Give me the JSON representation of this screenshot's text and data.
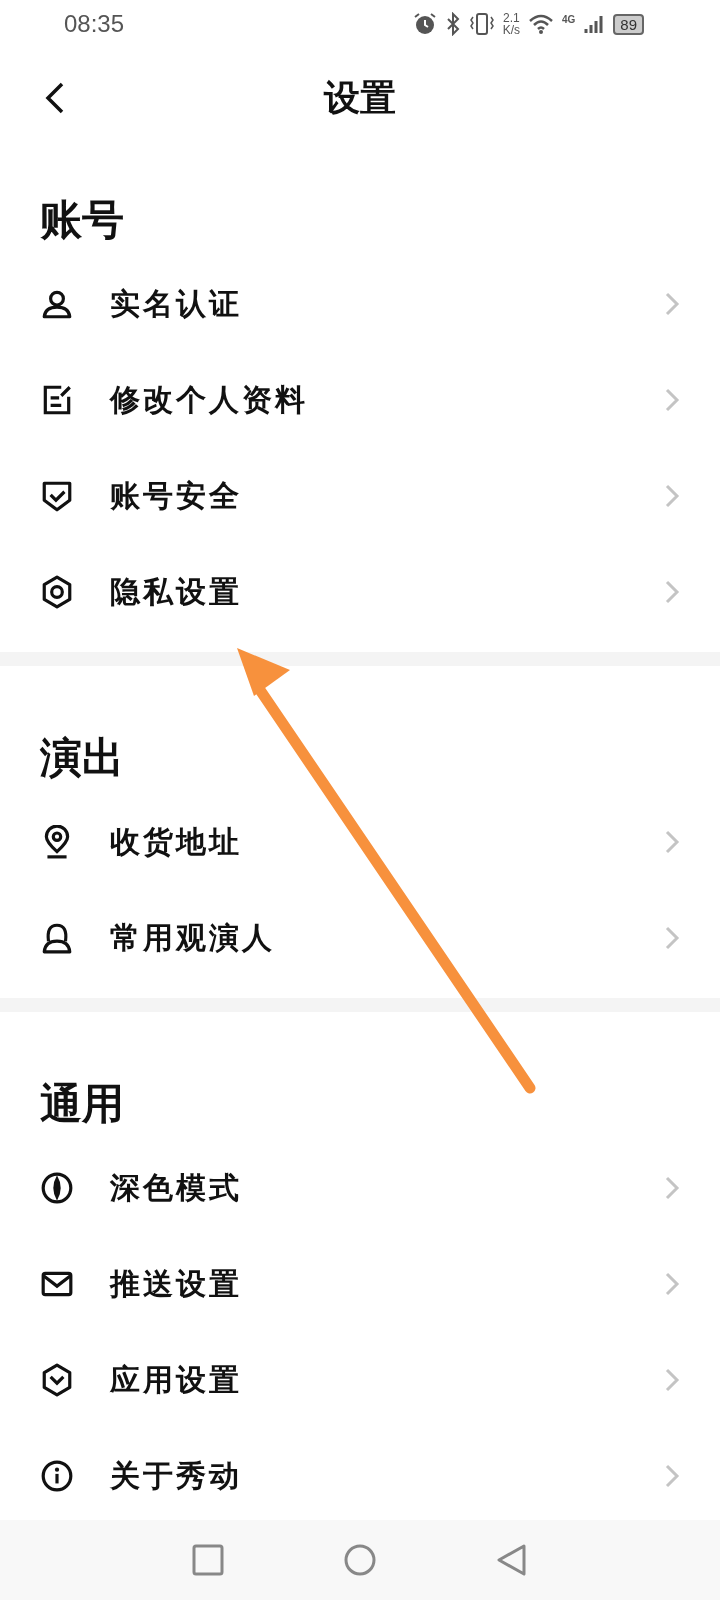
{
  "status_bar": {
    "time": "08:35",
    "speed_value": "2.1",
    "speed_unit": "K/s",
    "network": "4G",
    "battery": "89"
  },
  "header": {
    "title": "设置"
  },
  "sections": [
    {
      "title": "账号",
      "items": [
        {
          "label": "实名认证"
        },
        {
          "label": "修改个人资料"
        },
        {
          "label": "账号安全"
        },
        {
          "label": "隐私设置"
        }
      ]
    },
    {
      "title": "演出",
      "items": [
        {
          "label": "收货地址"
        },
        {
          "label": "常用观演人"
        }
      ]
    },
    {
      "title": "通用",
      "items": [
        {
          "label": "深色模式"
        },
        {
          "label": "推送设置"
        },
        {
          "label": "应用设置"
        },
        {
          "label": "关于秀动"
        }
      ]
    }
  ]
}
